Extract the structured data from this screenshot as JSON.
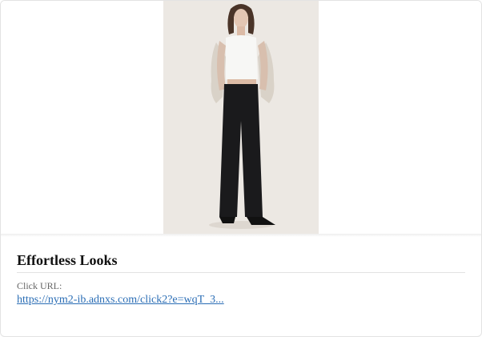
{
  "ad": {
    "title": "Effortless Looks",
    "click_url_label": "Click URL:",
    "click_url": "https://nym2-ib.adnxs.com/click2?e=wqT_3..."
  },
  "image": {
    "subject": "model-wearing-white-crop-top-and-black-wide-leg-trousers",
    "background_color": "#ece8e3"
  },
  "colors": {
    "link": "#2a6db5",
    "title": "#111111",
    "label": "#666666"
  }
}
